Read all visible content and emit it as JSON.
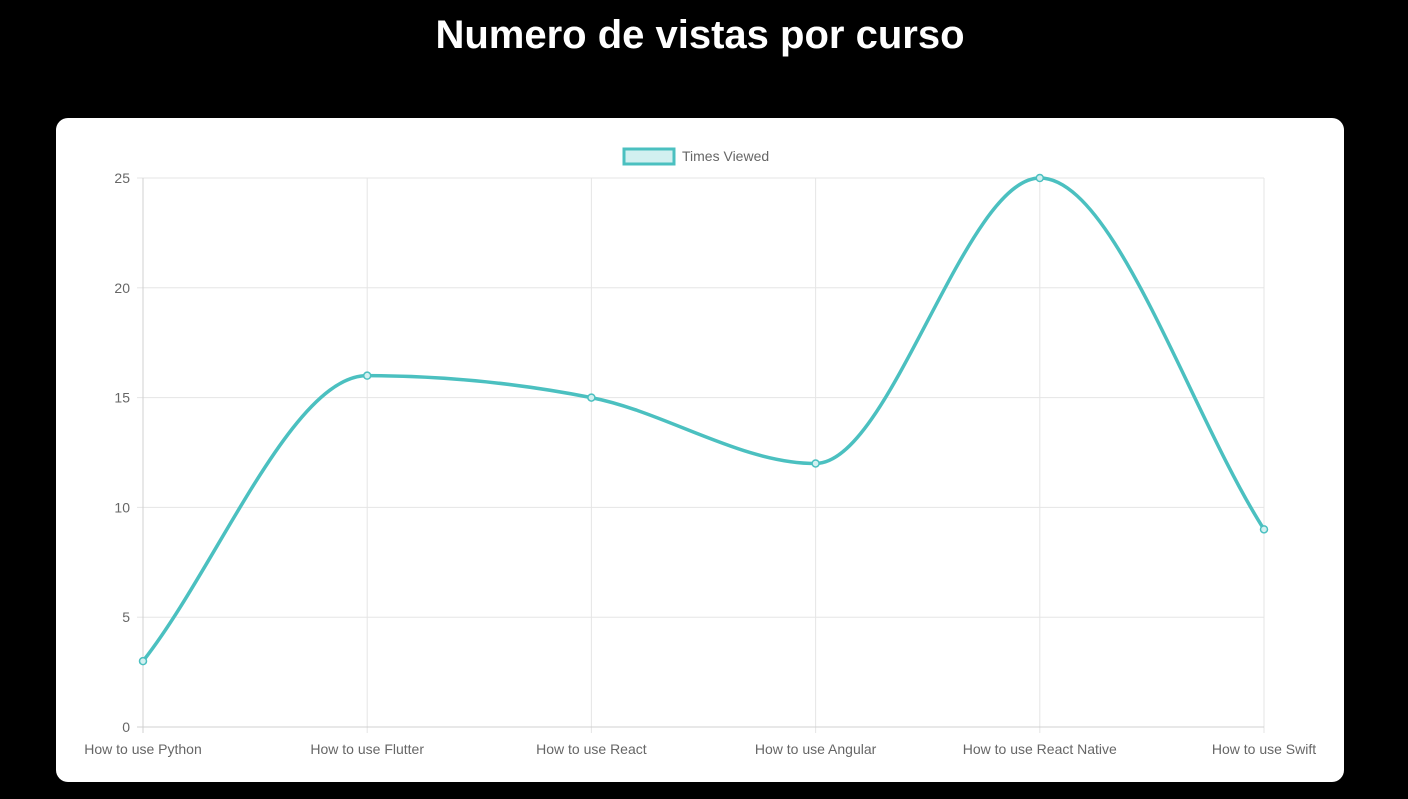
{
  "page": {
    "title": "Numero de vistas por curso"
  },
  "chart_data": {
    "type": "line",
    "categories": [
      "How to use Python",
      "How to use Flutter",
      "How to use React",
      "How to use Angular",
      "How to use React Native",
      "How to use Swift"
    ],
    "series": [
      {
        "name": "Times Viewed",
        "values": [
          3,
          16,
          15,
          12,
          25,
          9
        ],
        "color": "#4bc0c0",
        "fill_color": "#d2f0f0"
      }
    ],
    "ylim": [
      0,
      25
    ],
    "y_ticks": [
      0,
      5,
      10,
      15,
      20,
      25
    ],
    "grid": true,
    "legend_position": "top",
    "curve": "smooth"
  }
}
